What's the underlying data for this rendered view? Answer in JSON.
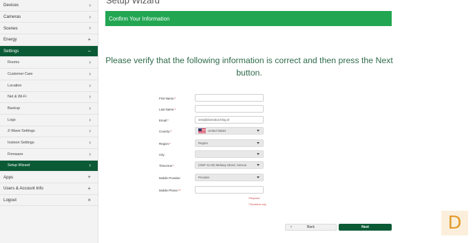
{
  "sidebar": {
    "items": [
      {
        "label": "Devices",
        "icon": "chevron-right-icon",
        "glyph": "›",
        "type": "top"
      },
      {
        "label": "Cameras",
        "icon": "chevron-right-icon",
        "glyph": "›",
        "type": "top"
      },
      {
        "label": "Scenes",
        "icon": "chevron-right-icon",
        "glyph": "›",
        "type": "top"
      },
      {
        "label": "Energy",
        "icon": "plus-icon",
        "glyph": "+",
        "type": "top"
      },
      {
        "label": "Settings",
        "icon": "minus-icon",
        "glyph": "−",
        "type": "active"
      },
      {
        "label": "Rooms",
        "icon": "chevron-right-icon",
        "glyph": "›",
        "type": "sub"
      },
      {
        "label": "Customer Care",
        "icon": "chevron-right-icon",
        "glyph": "›",
        "type": "sub"
      },
      {
        "label": "Location",
        "icon": "chevron-right-icon",
        "glyph": "›",
        "type": "sub"
      },
      {
        "label": "Net & Wi-Fi",
        "icon": "chevron-right-icon",
        "glyph": "›",
        "type": "sub"
      },
      {
        "label": "Backup",
        "icon": "chevron-right-icon",
        "glyph": "›",
        "type": "sub"
      },
      {
        "label": "Logs",
        "icon": "chevron-right-icon",
        "glyph": "›",
        "type": "sub"
      },
      {
        "label": "Z-Wave Settings",
        "icon": "chevron-right-icon",
        "glyph": "›",
        "type": "sub"
      },
      {
        "label": "Insteon Settings",
        "icon": "chevron-right-icon",
        "glyph": "›",
        "type": "sub"
      },
      {
        "label": "Firmware",
        "icon": "chevron-right-icon",
        "glyph": "›",
        "type": "sub"
      },
      {
        "label": "Setup Wizard",
        "icon": "chevron-right-icon",
        "glyph": "›",
        "type": "selected"
      },
      {
        "label": "Apps",
        "icon": "plus-icon",
        "glyph": "+",
        "type": "top"
      },
      {
        "label": "Users & Account Info",
        "icon": "plus-icon",
        "glyph": "+",
        "type": "top"
      },
      {
        "label": "Logout",
        "icon": "close-icon",
        "glyph": "×",
        "type": "top"
      }
    ]
  },
  "main": {
    "title": "Setup Wizard",
    "banner": "Confirm Your Information",
    "verify_text": "Please verify that the following information is correct and then press the Next button."
  },
  "form": {
    "first_name": {
      "label": "First Name:",
      "req": "*",
      "value": ""
    },
    "last_name": {
      "label": "Last Name:",
      "req": "*",
      "value": ""
    },
    "email": {
      "label": "Email:",
      "req": "*",
      "value": "vera@domotica-blog.nl"
    },
    "country": {
      "label": "Country:",
      "req": "*",
      "value": "United States"
    },
    "region": {
      "label": "Region:",
      "req": "*",
      "value": "Region"
    },
    "city": {
      "label": "City:",
      "req": "",
      "value": ""
    },
    "timezone": {
      "label": "Timezone:",
      "req": "*",
      "value": "(GMT-11:00) Midway Island, Samoa"
    },
    "mobile_provider": {
      "label": "Mobile Provider:",
      "req": "",
      "value": "Provider"
    },
    "mobile_phone": {
      "label": "Mobile Phone:",
      "req": "**",
      "value": ""
    },
    "note_required": "*Required",
    "note_numbers": "**Numbers only"
  },
  "buttons": {
    "back": "Back",
    "back_arrow": "‹",
    "next": "Next"
  },
  "logo": {
    "letter": "D"
  },
  "colors": {
    "banner": "#22a652",
    "sidebar_active": "#0b5a36",
    "next_button": "#0b5a36",
    "logo": "#e39b2b"
  }
}
